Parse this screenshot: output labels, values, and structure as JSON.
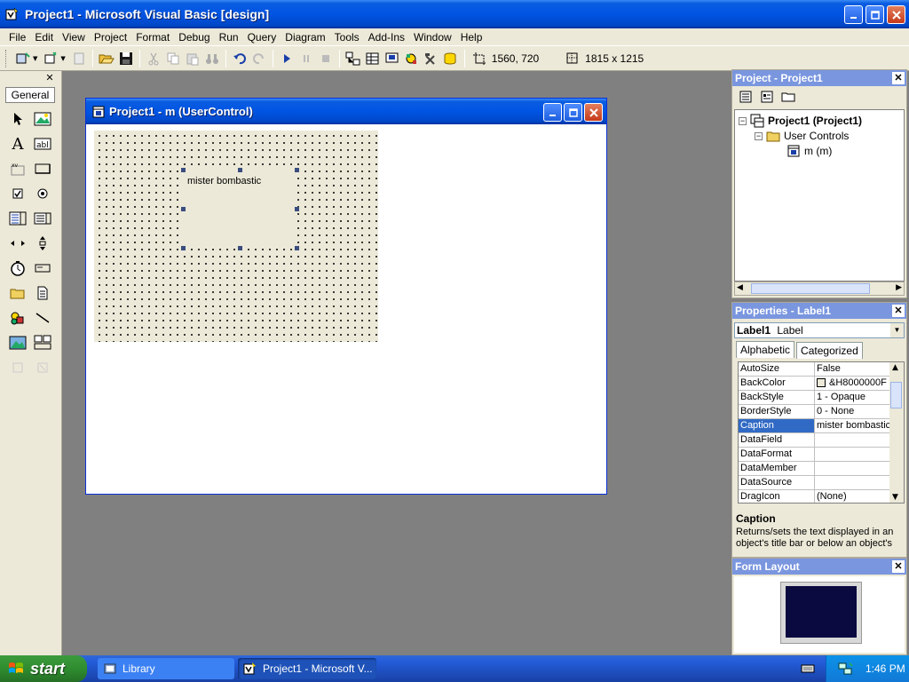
{
  "window": {
    "title": "Project1 - Microsoft Visual Basic [design]"
  },
  "menu": [
    "File",
    "Edit",
    "View",
    "Project",
    "Format",
    "Debug",
    "Run",
    "Query",
    "Diagram",
    "Tools",
    "Add-Ins",
    "Window",
    "Help"
  ],
  "toolbar": {
    "position": "1560, 720",
    "size": "1815 x 1215"
  },
  "toolbox": {
    "tab_label": "General"
  },
  "designer": {
    "title": "Project1 - m (UserControl)",
    "label_caption": "mister bombastic"
  },
  "project_explorer": {
    "title": "Project - Project1",
    "tree": {
      "project": "Project1 (Project1)",
      "folder": "User Controls",
      "item": "m (m)"
    }
  },
  "properties": {
    "title": "Properties - Label1",
    "object_name": "Label1",
    "object_type": "Label",
    "tabs": [
      "Alphabetic",
      "Categorized"
    ],
    "rows": [
      {
        "name": "AutoSize",
        "value": "False"
      },
      {
        "name": "BackColor",
        "value": "&H8000000F"
      },
      {
        "name": "BackStyle",
        "value": "1 - Opaque"
      },
      {
        "name": "BorderStyle",
        "value": "0 - None"
      },
      {
        "name": "Caption",
        "value": "mister bombastic"
      },
      {
        "name": "DataField",
        "value": ""
      },
      {
        "name": "DataFormat",
        "value": ""
      },
      {
        "name": "DataMember",
        "value": ""
      },
      {
        "name": "DataSource",
        "value": ""
      },
      {
        "name": "DragIcon",
        "value": "(None)"
      }
    ],
    "description_title": "Caption",
    "description_text": "Returns/sets the text displayed in an object's title bar or below an object's"
  },
  "form_layout": {
    "title": "Form Layout"
  },
  "taskbar": {
    "start_label": "start",
    "tasks": [
      "Library",
      "Project1 - Microsoft V..."
    ],
    "clock": "1:46 PM"
  },
  "colors": {
    "titlebar": "#0054e3",
    "selection": "#316ac5",
    "workspace": "#808080"
  }
}
